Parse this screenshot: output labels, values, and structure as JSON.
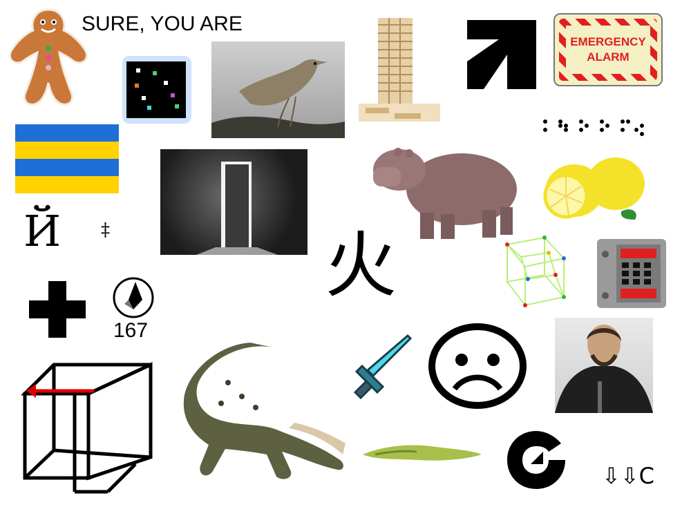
{
  "texts": {
    "caption": "SURE, YOU ARE",
    "cyr": "Й",
    "dagger": "‡",
    "cjk": "火",
    "compass_number": "167",
    "arrows_c": "⇩⇩C",
    "sign_line1": "EMERGENCY",
    "sign_line2": "ALARM"
  },
  "colors": {
    "flag_blue": "#1f6fd6",
    "flag_yellow": "#ffd200",
    "sign_red": "#e02020",
    "sign_bg": "#fff7c0",
    "lemon": "#f4e12a",
    "leaf": "#2f8f2f",
    "cube_line": "#b8f07a",
    "red_arrow": "#e00000"
  },
  "icons": [
    "gingerbread-icon",
    "pixel-board-icon",
    "bird-photo",
    "jenga-tower-icon",
    "arrow-logo-icon",
    "emergency-alarm-sign",
    "braille-dots-icon",
    "striped-flag-icon",
    "door-light-photo",
    "hippo-icon",
    "lemon-icon",
    "tesseract-wire-icon",
    "pixel-safe-icon",
    "plus-icon",
    "compass-icon",
    "wire-cube-icon",
    "crocodile-icon",
    "pixel-sword-icon",
    "sad-face-icon",
    "portrait-photo",
    "grass-patch-icon",
    "circular-logo-icon"
  ]
}
